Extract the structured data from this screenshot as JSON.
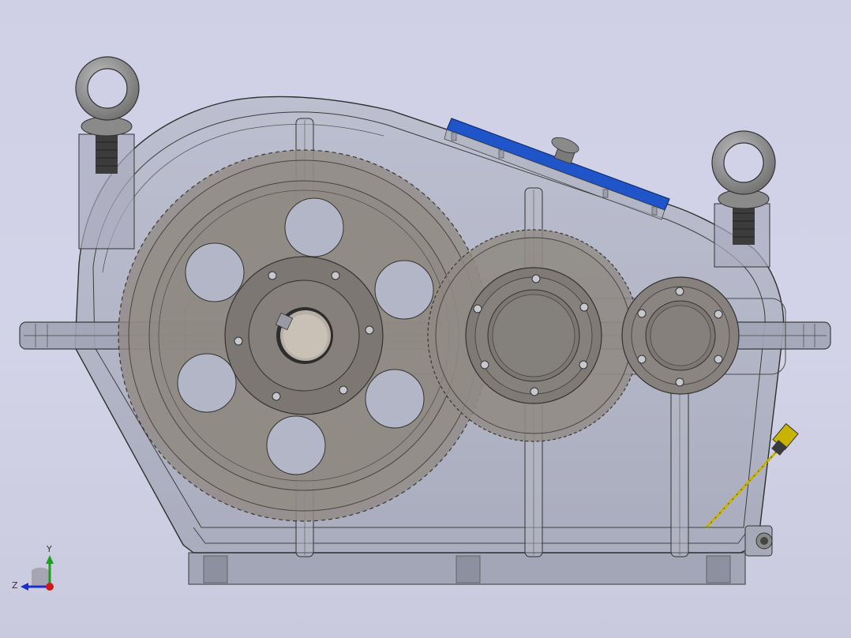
{
  "viewport": {
    "background_top": "#cfcfe6",
    "background_bottom": "#cacade"
  },
  "triad": {
    "y_label": "Y",
    "z_label": "Z",
    "y_color": "#1aa01a",
    "z_color": "#1a2fd0",
    "x_color": "#d01a1a"
  },
  "model": {
    "housing_color": "#a9abbd",
    "gear_color": "#8f8983",
    "cover_color": "#1f55c8",
    "eyebolt_color": "#8d8d8d",
    "dipstick_color": "#c8b400"
  }
}
